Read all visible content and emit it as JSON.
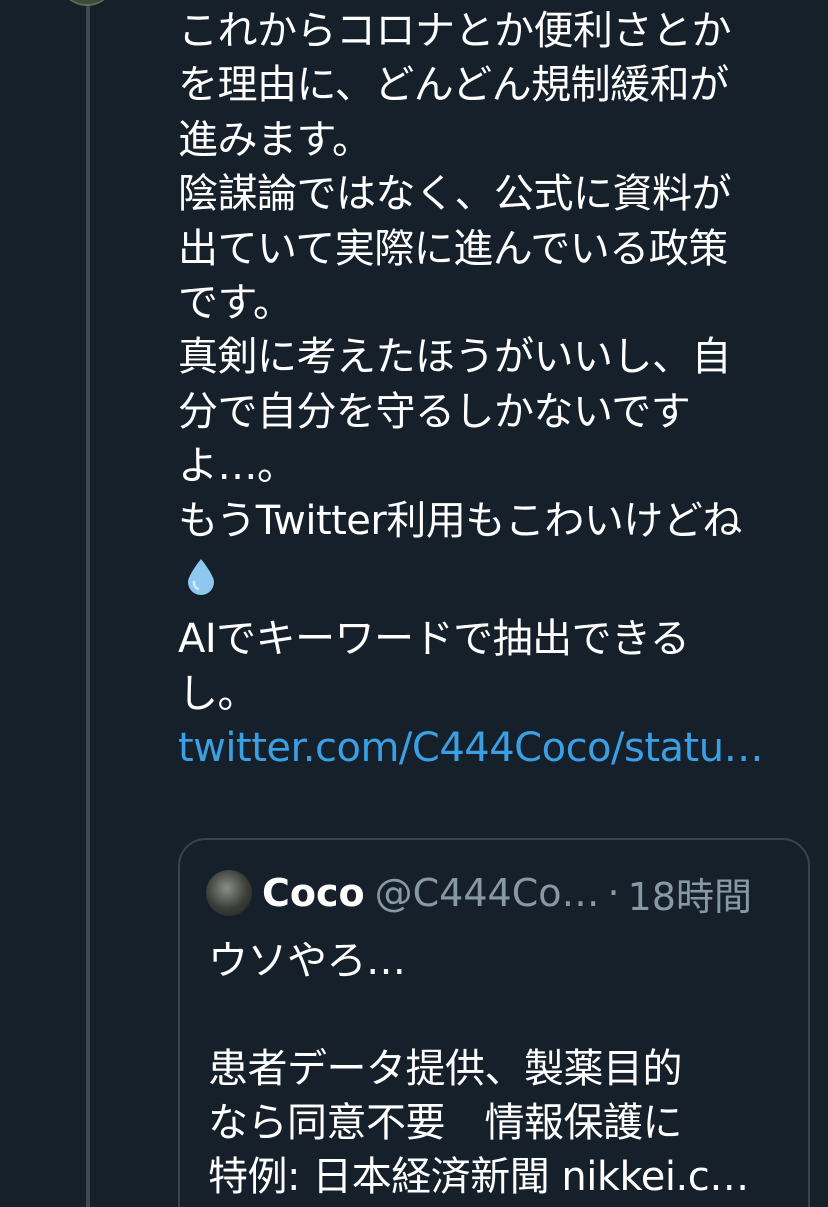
{
  "tweet": {
    "lines": [
      "これからコロナとか便利さとか",
      "を理由に、どんどん規制緩和が",
      "進みます。",
      "陰謀論ではなく、公式に資料が",
      "出ていて実際に進んでいる政策",
      "です。",
      "真剣に考えたほうがいいし、自",
      "分で自分を守るしかないです",
      "よ…。",
      "もうTwitter利用もこわいけどね"
    ],
    "emoji_icon": "droplet-icon",
    "lines_after": [
      "AIでキーワードで抽出できる",
      "し。"
    ],
    "link": "twitter.com/C444Coco/statu…"
  },
  "quote": {
    "name": "Coco",
    "handle": "@C444Co…",
    "separator": "·",
    "time": "18時間",
    "lines": [
      "ウソやろ…",
      "",
      "患者データ提供、製薬目的",
      "なら同意不要　情報保護に",
      "特例: 日本経済新聞 nikkei.c…"
    ]
  },
  "colors": {
    "background": "#15202b",
    "link": "#3b9fe4",
    "muted": "#8899a6",
    "border": "#38444d",
    "droplet": "#8ec8f0"
  }
}
